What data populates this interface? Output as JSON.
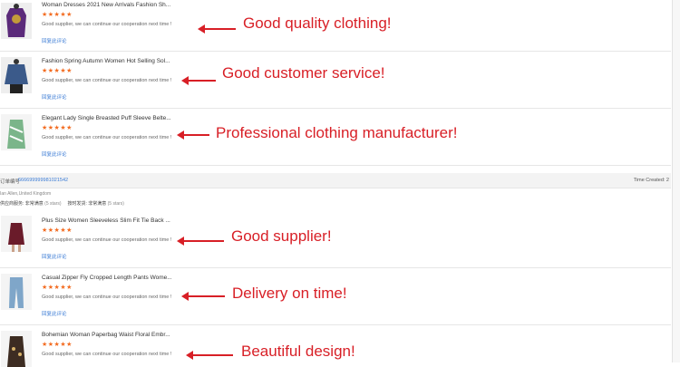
{
  "colors": {
    "accent_red": "#d81f26",
    "star_orange": "#f36c21",
    "link_blue": "#3a7bd5"
  },
  "items_top": [
    {
      "title": "Woman Dresses 2021 New Arrivals Fashion Sh...",
      "stars": "★★★★★",
      "review": "Good supplier, we can continue our cooperation next time !",
      "link": "回复此评论",
      "caption": "Good quality clothing!"
    },
    {
      "title": "Fashion Spring Autumn Women Hot Selling Sol...",
      "stars": "★★★★★",
      "review": "Good supplier, we can continue our cooperation next time !",
      "link": "回复此评论",
      "caption": "Good customer service!"
    },
    {
      "title": "Elegant Lady Single Breasted Puff Sleeve Belte...",
      "stars": "★★★★★",
      "review": "Good supplier, we can continue our cooperation next time !",
      "link": "回复此评论",
      "caption": "Professional clothing manufacturer!"
    }
  ],
  "order": {
    "label": "订单编号",
    "number": "666699999981021542",
    "time_label": "Time Created: 2",
    "buyer": "Ian Allen,United Kingdom",
    "rating_a_label": "供应商服务: 非常满意",
    "rating_a_count": "(5 stars)",
    "rating_b_label": "按时发货: 非常满意",
    "rating_b_count": "(5 stars)"
  },
  "items_bottom": [
    {
      "title": "Plus Size Women Sleeveless Slim Fit Tie Back ...",
      "stars": "★★★★★",
      "review": "Good supplier, we can continue our cooperation next time !",
      "link": "回复此评论",
      "caption": "Good supplier!"
    },
    {
      "title": "Casual Zipper Fly Cropped Length Pants Wome...",
      "stars": "★★★★★",
      "review": "Good supplier, we can continue our cooperation next time !",
      "link": "回复此评论",
      "caption": "Delivery on time!"
    },
    {
      "title": "Bohemian Woman Paperbag Waist Floral Embr...",
      "stars": "★★★★★",
      "review": "Good supplier, we can continue our cooperation next time !",
      "link": "",
      "caption": "Beautiful design!"
    }
  ]
}
